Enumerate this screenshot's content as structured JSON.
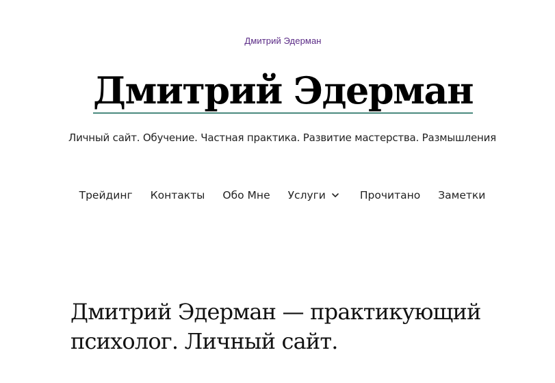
{
  "header": {
    "logo_text": "Дмитрий Эдерман",
    "site_title": "Дмитрий Эдерман",
    "site_description": "Личный сайт. Обучение. Частная практика. Развитие мастерства. Размышления"
  },
  "nav": {
    "items": [
      {
        "label": "Трейдинг"
      },
      {
        "label": "Контакты"
      },
      {
        "label": "Обо Мне"
      },
      {
        "label": "Услуги",
        "has_submenu": true,
        "icon": "chevron-down-icon"
      },
      {
        "label": "Прочитано"
      },
      {
        "label": "Заметки"
      }
    ]
  },
  "main": {
    "entry_title": "Дмитрий Эдерман — практикующий психолог. Личный сайт."
  },
  "colors": {
    "logo": "#5a2a86",
    "title_underline": "#4a8a7e",
    "text": "#111111"
  }
}
